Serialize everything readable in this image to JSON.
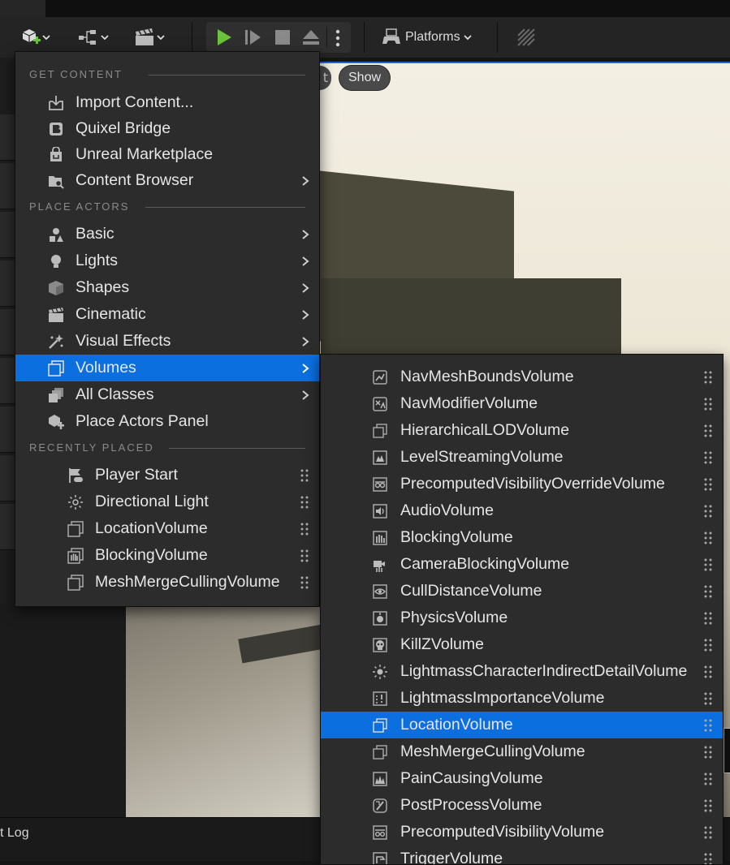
{
  "toolbar": {
    "platforms_label": "Platforms"
  },
  "viewport": {
    "show_label": "Show",
    "partial_label": "t"
  },
  "bottom": {
    "log_label": "t Log"
  },
  "menu": {
    "get_content_header": "GET CONTENT",
    "place_actors_header": "PLACE ACTORS",
    "recently_placed_header": "RECENTLY PLACED",
    "get_content": [
      {
        "label": "Import Content...",
        "icon": "import-icon",
        "submenu": false
      },
      {
        "label": "Quixel Bridge",
        "icon": "bridge-icon",
        "submenu": false
      },
      {
        "label": "Unreal Marketplace",
        "icon": "marketplace-icon",
        "submenu": false
      },
      {
        "label": "Content Browser",
        "icon": "content-browser-icon",
        "submenu": true
      }
    ],
    "place_actors": [
      {
        "label": "Basic",
        "icon": "basic-icon",
        "submenu": true
      },
      {
        "label": "Lights",
        "icon": "lightbulb-icon",
        "submenu": true
      },
      {
        "label": "Shapes",
        "icon": "cube-icon",
        "submenu": true
      },
      {
        "label": "Cinematic",
        "icon": "clapper-icon",
        "submenu": true
      },
      {
        "label": "Visual Effects",
        "icon": "sparkle-icon",
        "submenu": true
      },
      {
        "label": "Volumes",
        "icon": "volume-icon",
        "submenu": true,
        "selected": true
      },
      {
        "label": "All Classes",
        "icon": "all-classes-icon",
        "submenu": true
      },
      {
        "label": "Place Actors Panel",
        "icon": "place-actors-icon",
        "submenu": false
      }
    ],
    "recently_placed": [
      {
        "label": "Player Start",
        "icon": "player-start-icon"
      },
      {
        "label": "Directional Light",
        "icon": "directional-light-icon"
      },
      {
        "label": "LocationVolume",
        "icon": "volume-icon"
      },
      {
        "label": "BlockingVolume",
        "icon": "blocking-volume-icon"
      },
      {
        "label": "MeshMergeCullingVolume",
        "icon": "volume-icon"
      }
    ]
  },
  "volumes_submenu": [
    {
      "label": "NavMeshBoundsVolume",
      "icon": "nav-mesh-icon"
    },
    {
      "label": "NavModifierVolume",
      "icon": "nav-modifier-icon"
    },
    {
      "label": "HierarchicalLODVolume",
      "icon": "volume-icon"
    },
    {
      "label": "LevelStreamingVolume",
      "icon": "level-streaming-icon"
    },
    {
      "label": "PrecomputedVisibilityOverrideVolume",
      "icon": "visibility-override-icon"
    },
    {
      "label": "AudioVolume",
      "icon": "audio-icon"
    },
    {
      "label": "BlockingVolume",
      "icon": "blocking-volume-icon"
    },
    {
      "label": "CameraBlockingVolume",
      "icon": "camera-blocking-icon"
    },
    {
      "label": "CullDistanceVolume",
      "icon": "eye-icon"
    },
    {
      "label": "PhysicsVolume",
      "icon": "physics-icon"
    },
    {
      "label": "KillZVolume",
      "icon": "skull-icon"
    },
    {
      "label": "LightmassCharacterIndirectDetailVolume",
      "icon": "sun-icon"
    },
    {
      "label": "LightmassImportanceVolume",
      "icon": "lightmass-importance-icon"
    },
    {
      "label": "LocationVolume",
      "icon": "volume-icon",
      "selected": true
    },
    {
      "label": "MeshMergeCullingVolume",
      "icon": "volume-icon"
    },
    {
      "label": "PainCausingVolume",
      "icon": "pain-icon"
    },
    {
      "label": "PostProcessVolume",
      "icon": "post-process-icon"
    },
    {
      "label": "PrecomputedVisibilityVolume",
      "icon": "visibility-icon"
    },
    {
      "label": "TriggerVolume",
      "icon": "trigger-icon"
    }
  ],
  "colors": {
    "accent": "#0b6fe0",
    "menu_bg": "#2c2c2c",
    "play_green": "#6ac33a"
  }
}
